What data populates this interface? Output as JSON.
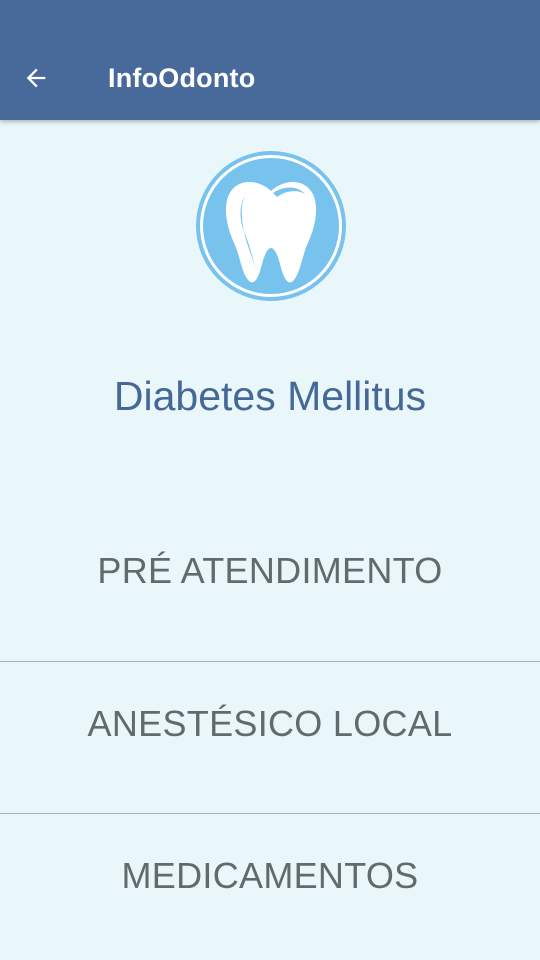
{
  "appbar": {
    "title": "InfoOdonto",
    "back_icon": "arrow-left-icon",
    "color": "#476a9a"
  },
  "logo": {
    "icon": "tooth-icon",
    "color": "#77c3ee"
  },
  "condition": {
    "title": "Diabetes Mellitus"
  },
  "menu": {
    "items": [
      {
        "label": "PRÉ ATENDIMENTO"
      },
      {
        "label": "ANESTÉSICO LOCAL"
      },
      {
        "label": "MEDICAMENTOS"
      }
    ]
  },
  "colors": {
    "background": "#e9f6fa",
    "title_text": "#456896",
    "menu_text": "#626a6c",
    "divider": "#a6b4b8"
  }
}
